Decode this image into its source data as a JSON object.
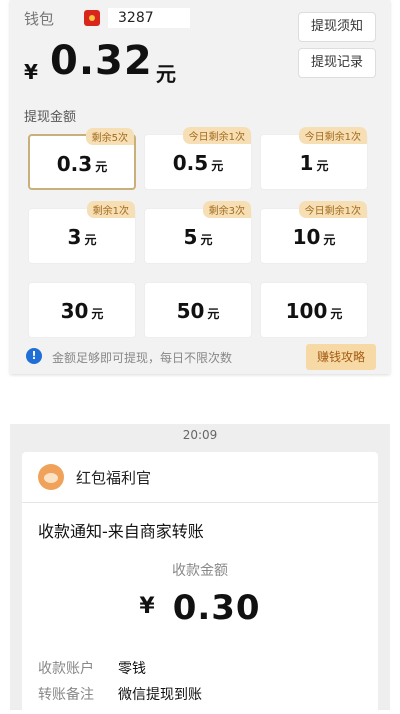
{
  "wallet": {
    "label": "钱包",
    "user_id": "3287",
    "currency_symbol": "¥",
    "balance": "0.32",
    "unit": "元"
  },
  "header_buttons": {
    "notice": "提现须知",
    "records": "提现记录"
  },
  "withdraw": {
    "section_title": "提现金额",
    "unit": "元",
    "options": [
      {
        "value": "0.3",
        "badge": "剩余5次"
      },
      {
        "value": "0.5",
        "badge": "今日剩余1次"
      },
      {
        "value": "1",
        "badge": "今日剩余1次"
      },
      {
        "value": "3",
        "badge": "剩余1次"
      },
      {
        "value": "5",
        "badge": "剩余3次"
      },
      {
        "value": "10",
        "badge": "今日剩余1次"
      },
      {
        "value": "30",
        "badge": ""
      },
      {
        "value": "50",
        "badge": ""
      },
      {
        "value": "100",
        "badge": ""
      }
    ],
    "selected_index": 0,
    "footer_note": "金额足够即可提现，每日不限次数",
    "tips_button": "赚钱攻略"
  },
  "message": {
    "time": "20:09",
    "sender": "红包福利官",
    "title": "收款通知-来自商家转账",
    "amount_label": "收款金额",
    "currency_symbol": "¥",
    "amount": "0.30",
    "rows": [
      {
        "key": "收款账户",
        "value": "零钱"
      },
      {
        "key": "转账备注",
        "value": "微信提现到账"
      }
    ]
  },
  "colors": {
    "badge_bg": "#f6dfb5",
    "badge_text": "#a36a1d",
    "selected_border": "#c9b07a",
    "tips_bg": "#f7d9a6",
    "info_icon": "#1f6fd6"
  }
}
